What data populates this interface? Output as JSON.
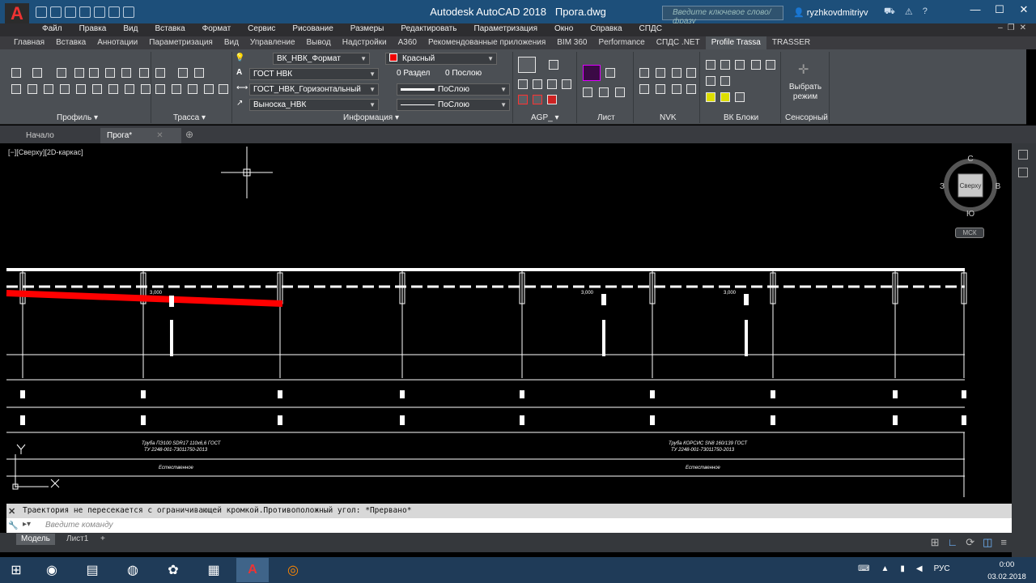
{
  "window": {
    "app_title": "Autodesk AutoCAD 2018",
    "file_name": "Прога.dwg",
    "search_placeholder": "Введите ключевое слово/фразу",
    "user": "ryzhkovdmitriyv",
    "minimize": "—",
    "maximize": "☐",
    "close": "✕"
  },
  "menu": [
    "Файл",
    "Правка",
    "Вид",
    "Вставка",
    "Формат",
    "Сервис",
    "Рисование",
    "Размеры",
    "Редактировать",
    "Параметризация",
    "Окно",
    "Справка",
    "СПДС"
  ],
  "ribbon_tabs": [
    {
      "label": "Главная",
      "active": false
    },
    {
      "label": "Вставка",
      "active": false
    },
    {
      "label": "Аннотации",
      "active": false
    },
    {
      "label": "Параметризация",
      "active": false
    },
    {
      "label": "Вид",
      "active": false
    },
    {
      "label": "Управление",
      "active": false
    },
    {
      "label": "Вывод",
      "active": false
    },
    {
      "label": "Надстройки",
      "active": false
    },
    {
      "label": "A360",
      "active": false
    },
    {
      "label": "Рекомендованные приложения",
      "active": false
    },
    {
      "label": "BIM 360",
      "active": false
    },
    {
      "label": "Performance",
      "active": false
    },
    {
      "label": "СПДС .NET",
      "active": false
    },
    {
      "label": "Profile Trassa",
      "active": true
    },
    {
      "label": "TRASSER",
      "active": false
    }
  ],
  "ribbon": {
    "panels": {
      "profile": "Профиль ▾",
      "trassa": "Трасса ▾",
      "info": "Информация ▾",
      "agp": "AGP_ ▾",
      "list": "Лист",
      "nvk": "NVK",
      "vk_blocks": "ВК Блоки",
      "sensor": "Сенсорный"
    },
    "layer_combo": "ВК_НВК_Формат",
    "color_combo": "Красный",
    "textstyle_combo": "ГОСТ НВК",
    "dimstyle_combo": "ГОСТ_НВК_Горизонтальный",
    "mleader_combo": "Выноска_НВК",
    "razdel": "0 Раздел",
    "poslou_1": "0 Послою",
    "lineweight": "ПоСлою",
    "linetype": "ПоСлою",
    "select_mode": "Выбрать режим"
  },
  "doc_tabs": {
    "start": "Начало",
    "current": "Прога*"
  },
  "viewport": {
    "label": "[−][Сверху][2D-каркас]"
  },
  "navcube": {
    "north": "С",
    "south": "Ю",
    "west": "З",
    "east": "В",
    "face": "Сверху",
    "ucs": "МСК"
  },
  "drawing_text": {
    "pipe_note_1a": "Труба ПЭ100 SDR17 110х6,6 ГОСТ",
    "pipe_note_1b": "ТУ 2248-001-73011750-2013",
    "pipe_note_2a": "Труба КОРСИС SN8 160/139 ГОСТ",
    "pipe_note_2b": "ТУ 2248-001-73011750-2013",
    "base_1": "Естественное",
    "base_2": "Естественное",
    "elev_1": "3,000",
    "elev_2": "3,000",
    "elev_3": "3,000"
  },
  "command": {
    "history": "Траектория не пересекается с ограничивающей кромкой.Противоположный угол: *Прервано*",
    "prompt": "Введите команду"
  },
  "layout_tabs": {
    "model": "Модель",
    "sheet": "Лист1"
  },
  "taskbar": {
    "lang": "РУС",
    "time": "0:00",
    "date": "03.02.2018"
  },
  "colors": {
    "accent": "#1d4f7a",
    "red_polyline": "#ff0000",
    "drawing_bg": "#000000"
  }
}
